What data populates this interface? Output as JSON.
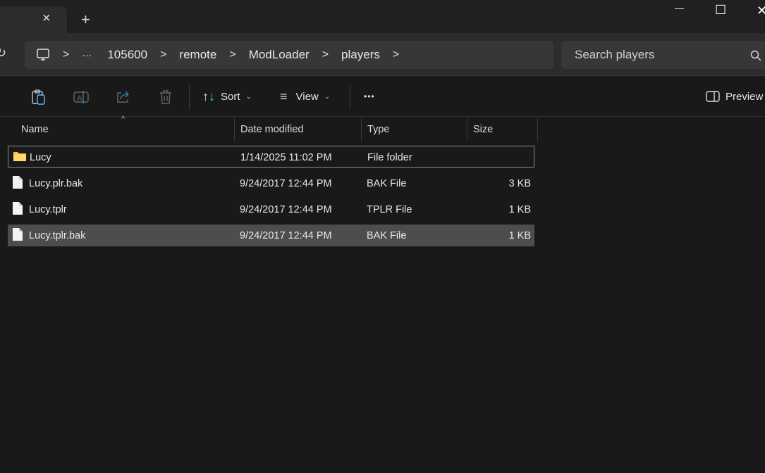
{
  "tab": {
    "close": "×",
    "new_tab": "+"
  },
  "window": {
    "minimize": "—",
    "maximize": "☐",
    "close": "✕"
  },
  "address": {
    "ellipsis": "···",
    "crumbs": [
      "105600",
      "remote",
      "ModLoader",
      "players"
    ]
  },
  "search": {
    "placeholder": "Search players"
  },
  "toolbar": {
    "sort": "Sort",
    "view": "View",
    "more": "•••",
    "preview": "Preview"
  },
  "columns": [
    "Name",
    "Date modified",
    "Type",
    "Size"
  ],
  "files": [
    {
      "name": "Lucy",
      "date": "1/14/2025 11:02 PM",
      "type": "File folder",
      "size": "",
      "icon": "folder-icon"
    },
    {
      "name": "Lucy.plr.bak",
      "date": "9/24/2017 12:44 PM",
      "type": "BAK File",
      "size": "3 KB",
      "icon": "file-icon"
    },
    {
      "name": "Lucy.tplr",
      "date": "9/24/2017 12:44 PM",
      "type": "TPLR File",
      "size": "1 KB",
      "icon": "file-icon"
    },
    {
      "name": "Lucy.tplr.bak",
      "date": "9/24/2017 12:44 PM",
      "type": "BAK File",
      "size": "1 KB",
      "icon": "file-icon"
    }
  ]
}
